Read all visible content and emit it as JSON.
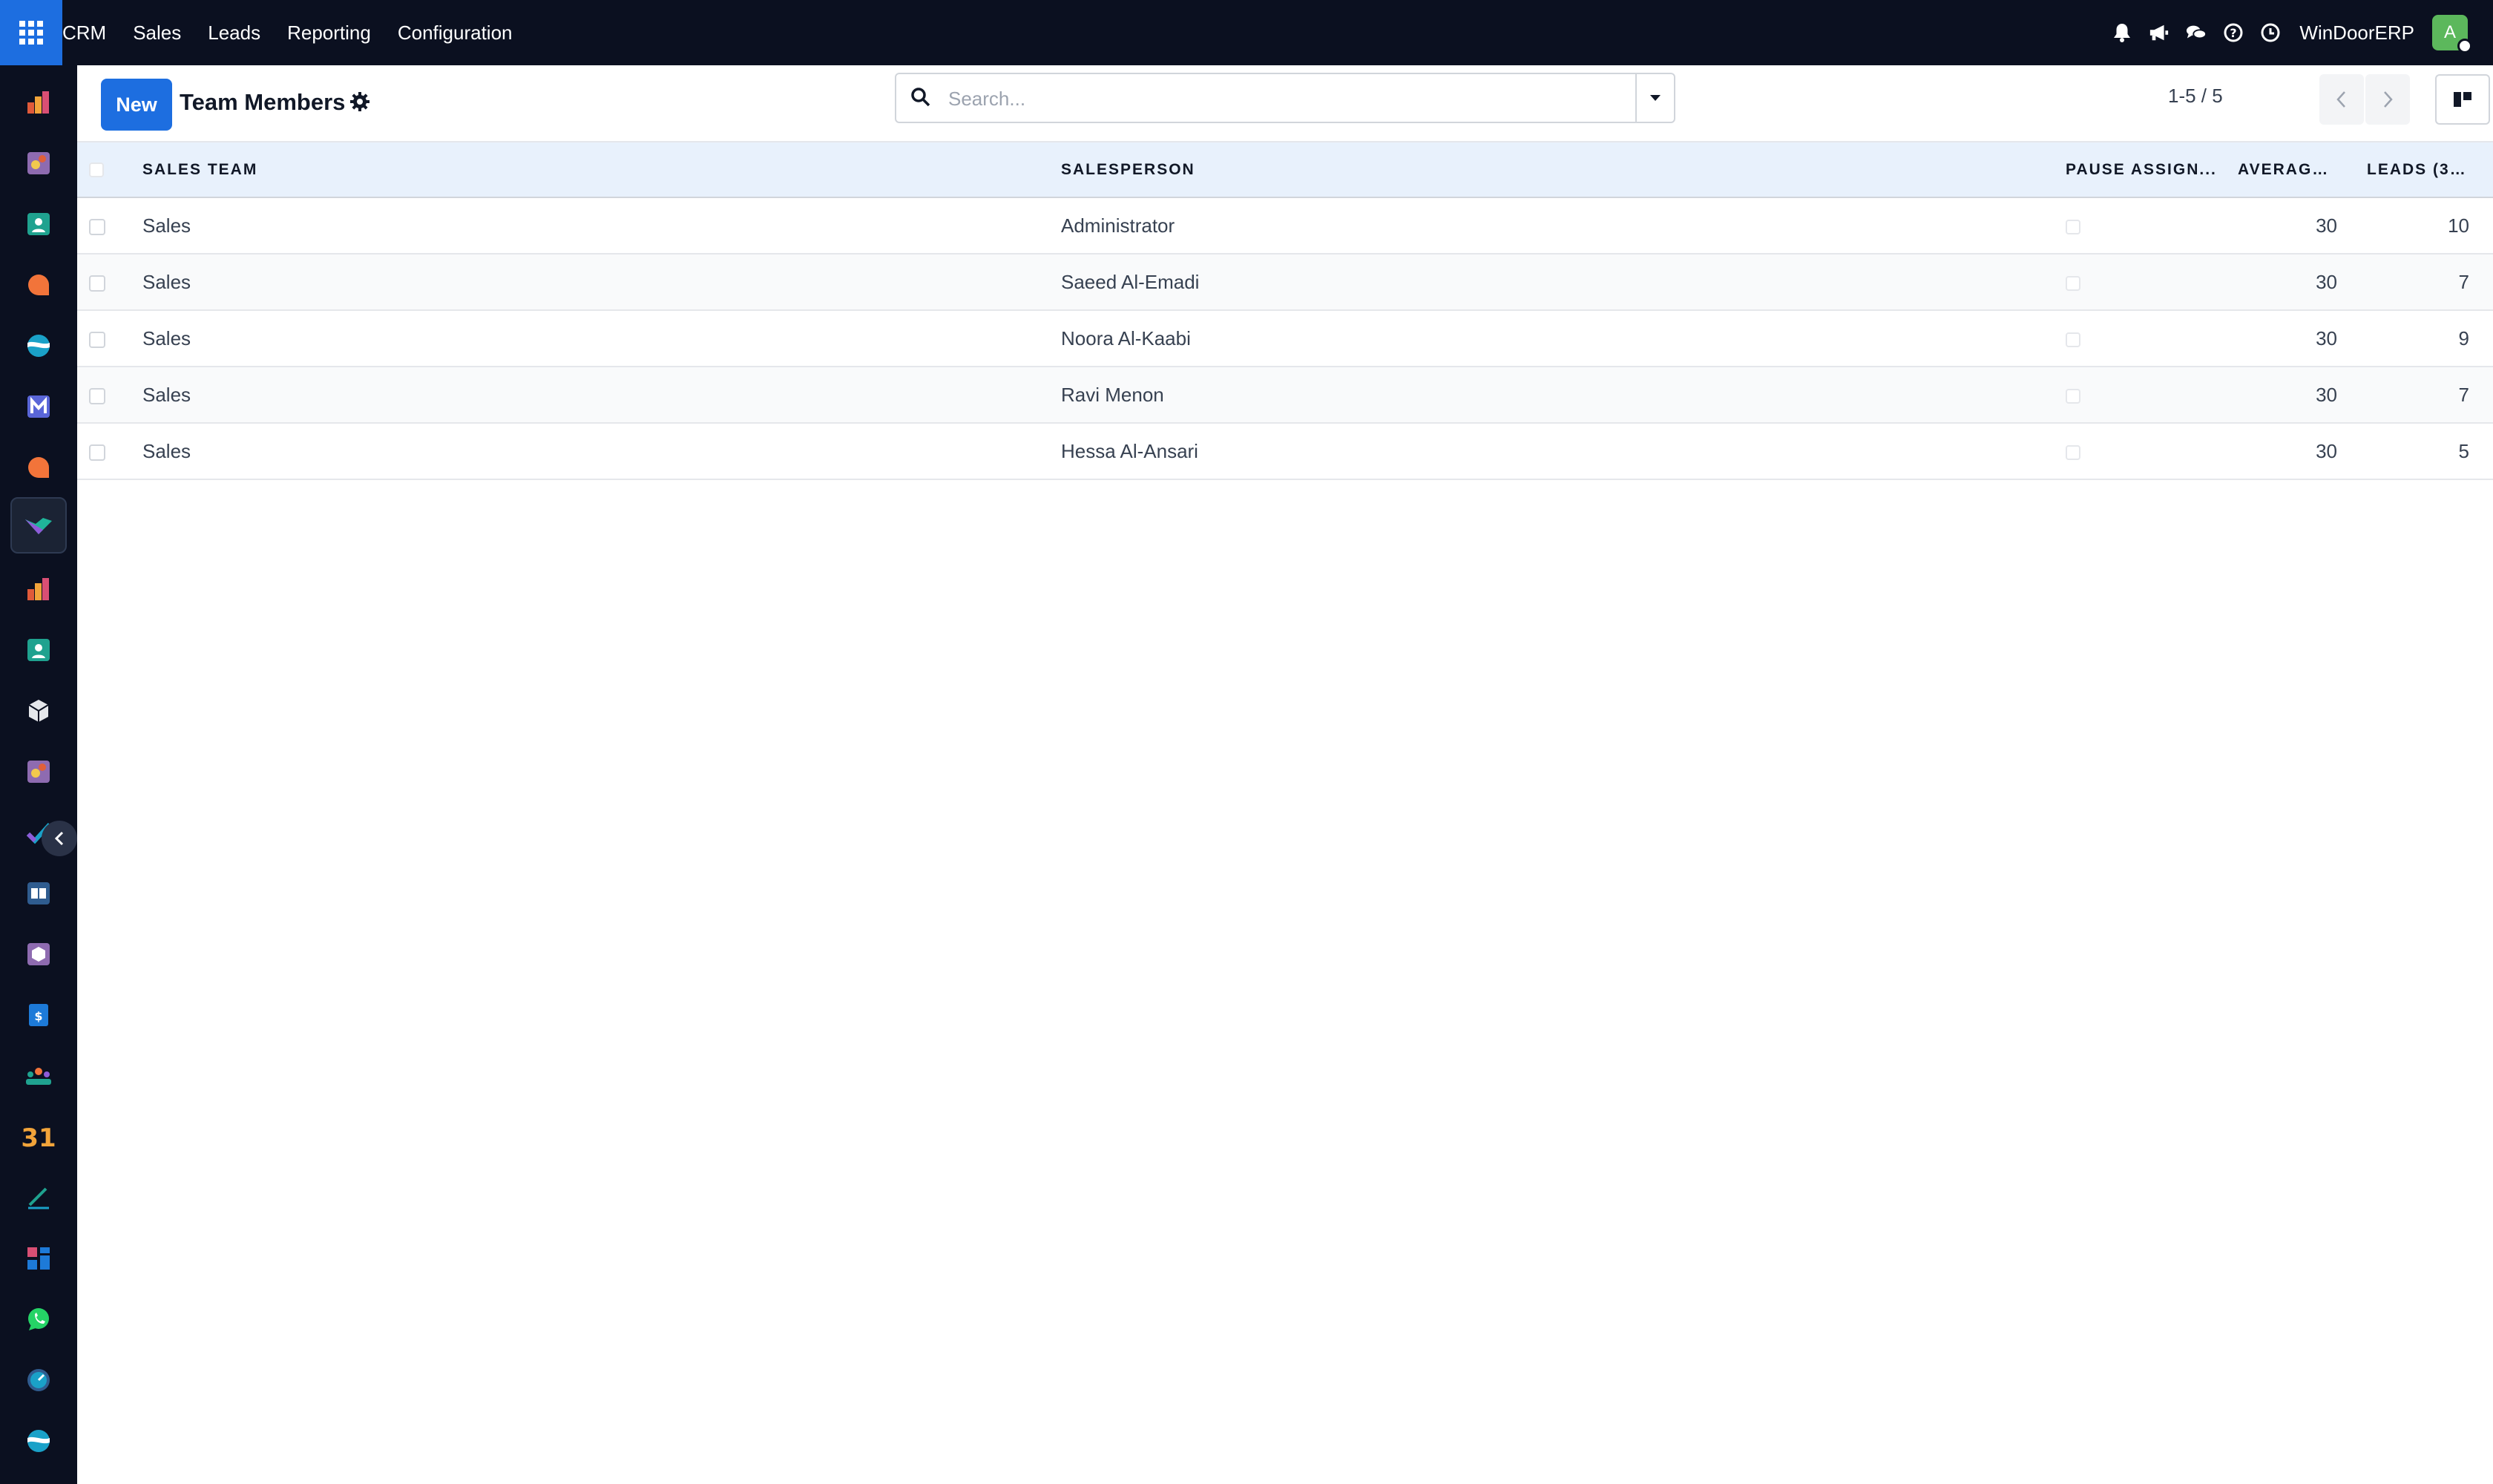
{
  "topbar": {
    "menu": [
      "CRM",
      "Sales",
      "Leads",
      "Reporting",
      "Configuration"
    ],
    "company": "WinDoorERP",
    "avatar_letter": "A"
  },
  "control": {
    "new_label": "New",
    "title": "Team Members",
    "search_placeholder": "Search...",
    "pager": "1-5 / 5"
  },
  "table": {
    "headers": [
      "SALES TEAM",
      "SALESPERSON",
      "PAUSE ASSIGN...",
      "AVERAGE ...",
      "LEADS (30..."
    ],
    "rows": [
      {
        "team": "Sales",
        "salesperson": "Administrator",
        "average": "30",
        "leads": "10"
      },
      {
        "team": "Sales",
        "salesperson": "Saeed Al-Emadi",
        "average": "30",
        "leads": "7"
      },
      {
        "team": "Sales",
        "salesperson": "Noora Al-Kaabi",
        "average": "30",
        "leads": "9"
      },
      {
        "team": "Sales",
        "salesperson": "Ravi Menon",
        "average": "30",
        "leads": "7"
      },
      {
        "team": "Sales",
        "salesperson": "Hessa Al-Ansari",
        "average": "30",
        "leads": "5"
      }
    ]
  },
  "colors": {
    "primary": "#1d6ee0",
    "topbar_bg": "#0b1020",
    "header_row_bg": "#e8f1fc"
  }
}
